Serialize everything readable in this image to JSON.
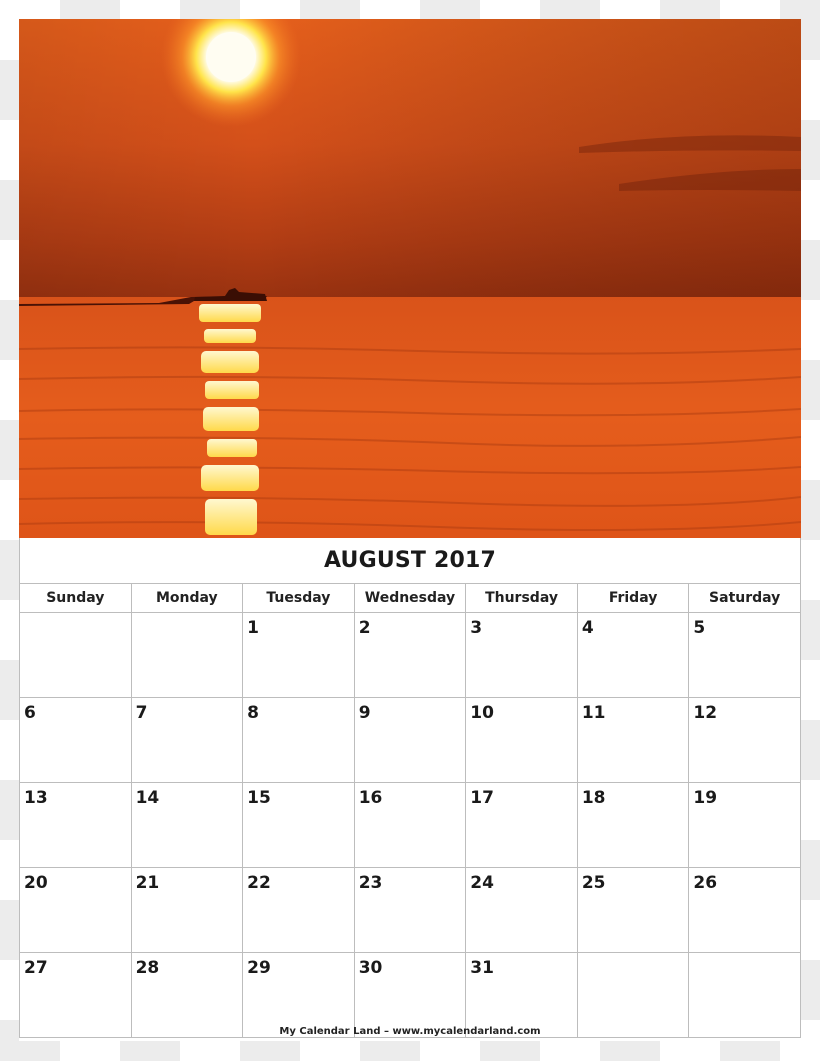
{
  "calendar": {
    "title": "AUGUST 2017",
    "photo": {
      "description": "Orange sunset over calm sea with a boat silhouette and sun reflection",
      "colors": {
        "sky_top": "#e0581a",
        "sky_mid": "#c9491a",
        "horizon": "#8f2d0e",
        "sea": "#e3591b",
        "sun": "#fffbe8",
        "glow": "#ffd23a"
      }
    },
    "weekdays": [
      "Sunday",
      "Monday",
      "Tuesday",
      "Wednesday",
      "Thursday",
      "Friday",
      "Saturday"
    ],
    "weeks": [
      [
        "",
        "",
        "1",
        "2",
        "3",
        "4",
        "5"
      ],
      [
        "6",
        "7",
        "8",
        "9",
        "10",
        "11",
        "12"
      ],
      [
        "13",
        "14",
        "15",
        "16",
        "17",
        "18",
        "19"
      ],
      [
        "20",
        "21",
        "22",
        "23",
        "24",
        "25",
        "26"
      ],
      [
        "27",
        "28",
        "29",
        "30",
        "31",
        "",
        ""
      ]
    ],
    "footer": "My Calendar Land – www.mycalendarland.com"
  }
}
